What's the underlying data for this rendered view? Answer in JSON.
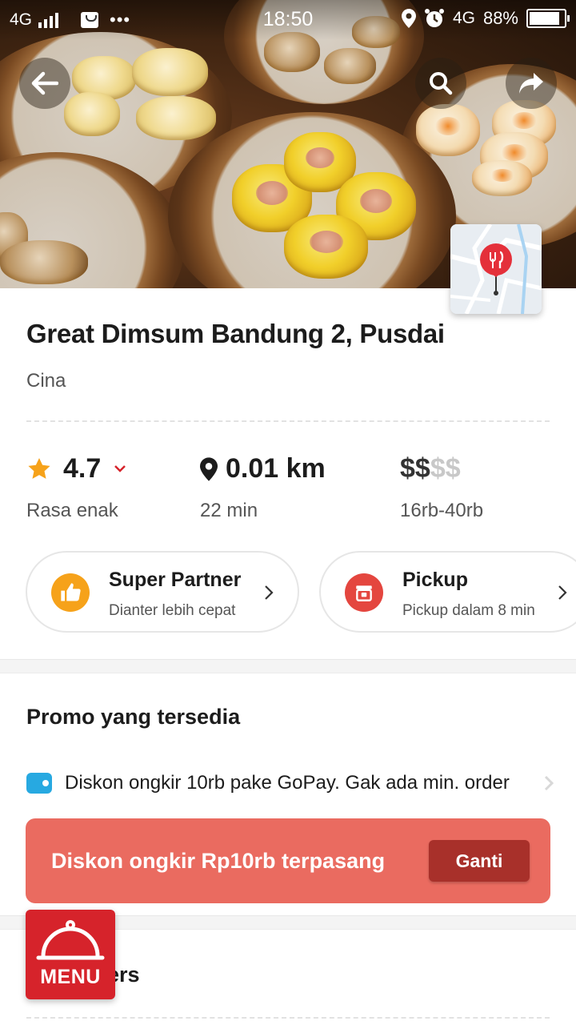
{
  "status_bar": {
    "network": "4G",
    "time": "18:50",
    "network_right": "4G",
    "battery": "88%",
    "battery_level": 0.88
  },
  "hero": {
    "back_icon": "arrow-left-icon",
    "search_icon": "search-icon",
    "share_icon": "share-icon",
    "map_icon": "map-restaurant-pin-icon"
  },
  "restaurant": {
    "name": "Great Dimsum Bandung 2, Pusdai",
    "cuisine": "Cina"
  },
  "stats": {
    "rating": "4.7",
    "rating_label": "Rasa enak",
    "distance": "0.01 km",
    "delivery_time": "22 min",
    "price_active": "$$",
    "price_inactive": "$$",
    "price_range": "16rb-40rb"
  },
  "badges": [
    {
      "title": "Super Partner",
      "subtitle": "Dianter lebih cepat",
      "icon": "thumbs-up-icon",
      "color": "#f6a21a"
    },
    {
      "title": "Pickup",
      "subtitle": "Pickup dalam 8 min",
      "icon": "store-icon",
      "color": "#e4463f"
    }
  ],
  "promo": {
    "section_title": "Promo yang tersedia",
    "item_text": "Diskon ongkir 10rb pake GoPay. Gak ada min. order",
    "item_icon": "wallet-icon",
    "banner_text": "Diskon ongkir Rp10rb terpasang",
    "banner_button": "Ganti"
  },
  "next_section": {
    "title_partial": "ers"
  },
  "menu_fab": {
    "label": "MENU",
    "icon": "cloche-icon"
  },
  "colors": {
    "accent_red": "#d6232b",
    "banner": "#ea6b60",
    "banner_button": "#a8302a",
    "star": "#f6a21a",
    "gopay": "#27a9e1"
  }
}
